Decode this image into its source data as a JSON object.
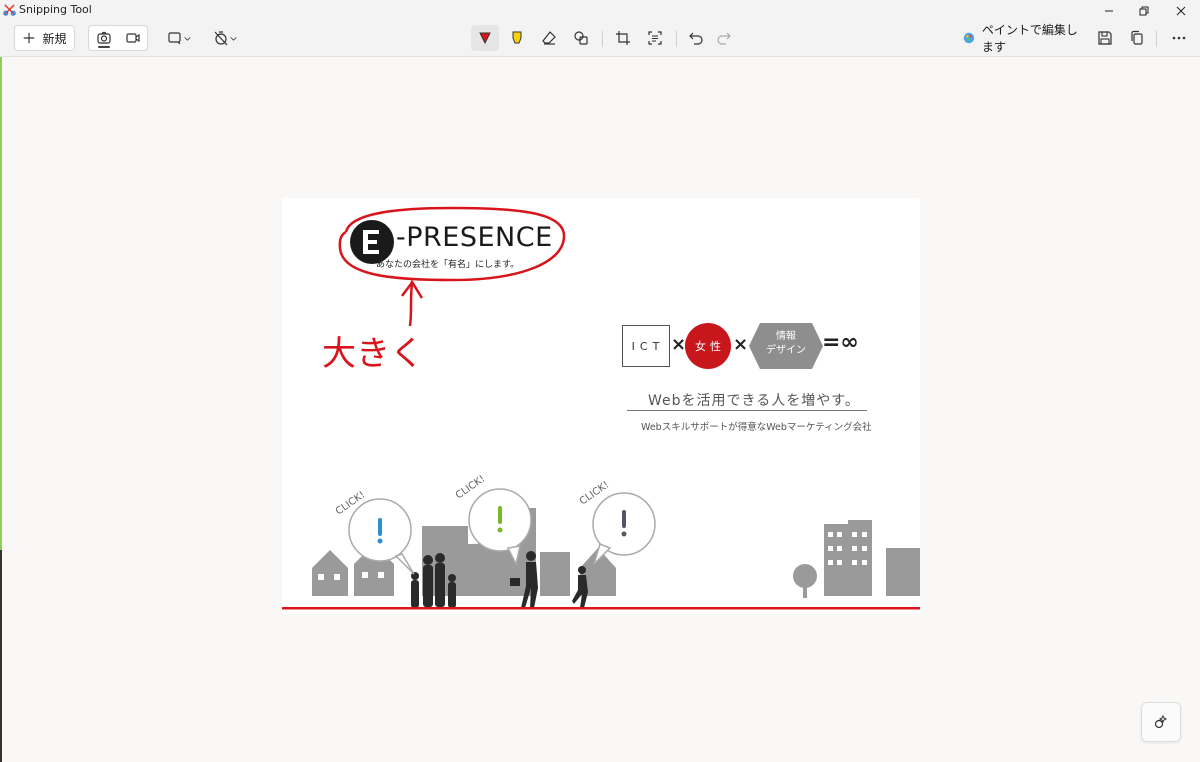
{
  "window": {
    "title": "Snipping Tool"
  },
  "toolbar": {
    "new_label": "新規",
    "paint_label": "ペイントで編集します"
  },
  "capture": {
    "logo": {
      "text": "-PRESENCE",
      "tagline": "あなたの会社を「有名」にします。"
    },
    "annotation": "大きく",
    "formula": {
      "ict": "ICT",
      "times": "×",
      "women": "女性",
      "design_line1": "情報",
      "design_line2": "デザイン",
      "equals_infinity": "=∞"
    },
    "headline": "Webを活用できる人を増やす。",
    "subline": "Webスキルサポートが得意なWebマーケティング会社",
    "click_label": "CLICK!",
    "bubble_mark": "!"
  },
  "colors": {
    "accent_red": "#d9151c",
    "circle_red": "#c8161d",
    "building_gray": "#9a9a9a",
    "bubble_blue": "#2a8fd6",
    "bubble_green": "#78b82a",
    "bubble_gray": "#555566"
  },
  "icons": {
    "new": "plus-icon",
    "screenshot_mode": "camera-icon",
    "video_mode": "video-icon",
    "shape": "rectangle-snip-icon",
    "delay": "timer-off-icon",
    "pen": "ballpoint-pen-icon",
    "highlighter": "highlighter-icon",
    "eraser": "eraser-icon",
    "shapes": "shapes-icon",
    "crop": "crop-icon",
    "text_actions": "text-actions-icon",
    "undo": "undo-icon",
    "redo": "redo-icon",
    "paint": "paint-icon",
    "save": "save-icon",
    "copy": "copy-icon",
    "more": "more-icon",
    "assist": "assistant-icon"
  }
}
